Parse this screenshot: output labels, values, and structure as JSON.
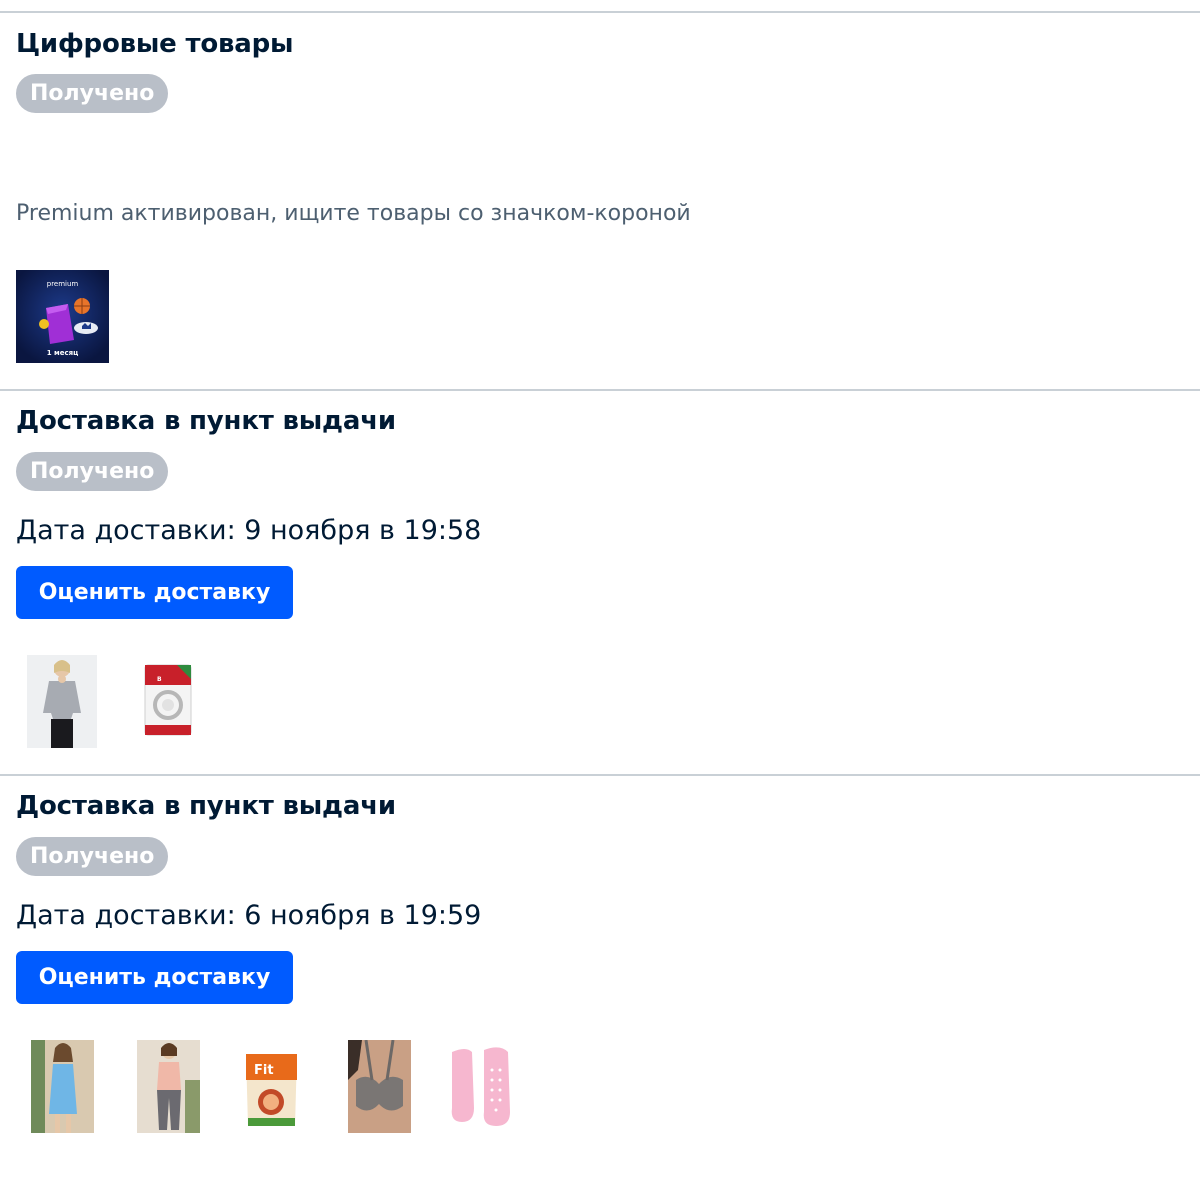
{
  "orders": [
    {
      "title": "Цифровые товары",
      "status": "Получено",
      "note": "Premium активирован, ищите товары со значком-короной",
      "items": [
        {
          "name": "premium-subscription",
          "label_top": "premium",
          "label_bottom": "1 месяц"
        }
      ]
    },
    {
      "title": "Доставка в пункт выдачи",
      "status": "Получено",
      "delivery_date": "Дата доставки: 9 ноября в 19:58",
      "rate_label": "Оценить доставку",
      "items": [
        {
          "name": "grey-longsleeve"
        },
        {
          "name": "bialetti-gasket"
        }
      ]
    },
    {
      "title": "Доставка в пункт выдачи",
      "status": "Получено",
      "delivery_date": "Дата доставки: 6 ноября в 19:59",
      "rate_label": "Оценить доставку",
      "items": [
        {
          "name": "blue-dress"
        },
        {
          "name": "pajama-set"
        },
        {
          "name": "fit-parad-sweetener"
        },
        {
          "name": "grey-bra"
        },
        {
          "name": "pink-gel-socks"
        }
      ]
    }
  ],
  "colors": {
    "accent": "#005bff",
    "badge": "#b9bfc8",
    "divider": "#c9d0d6",
    "text": "#001a34",
    "muted": "#4d5f70"
  }
}
